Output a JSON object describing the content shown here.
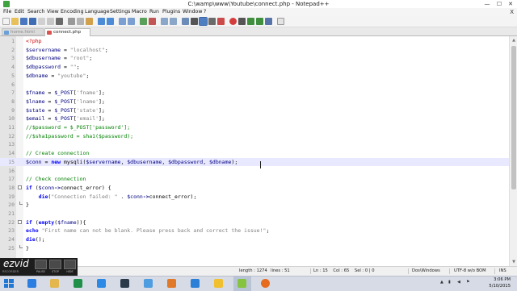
{
  "window": {
    "title": "C:\\wamp\\www\\Youtube\\connect.php - Notepad++",
    "minimize": "—",
    "maximize": "☐",
    "close": "✕"
  },
  "menu": [
    {
      "label": "File"
    },
    {
      "label": "Edit"
    },
    {
      "label": "Search"
    },
    {
      "label": "View"
    },
    {
      "label": "Encoding"
    },
    {
      "label": "Language"
    },
    {
      "label": "Settings"
    },
    {
      "label": "Macro"
    },
    {
      "label": "Run"
    },
    {
      "label": "Plugins"
    },
    {
      "label": "Window"
    },
    {
      "label": "?"
    }
  ],
  "menu_close": "X",
  "tabs": [
    {
      "label": "home.html",
      "active": false
    },
    {
      "label": "connect.php",
      "active": true
    }
  ],
  "code_lines": [
    {
      "n": "1",
      "html": "<span class=\"c-tag\">&lt;?php</span>"
    },
    {
      "n": "2",
      "html": "<span class=\"c-var\">$servername</span> = <span class=\"c-str\">\"localhost\"</span>;"
    },
    {
      "n": "3",
      "html": "<span class=\"c-var\">$dbusername</span> = <span class=\"c-str\">\"root\"</span>;"
    },
    {
      "n": "4",
      "html": "<span class=\"c-var\">$dbpassword</span> = <span class=\"c-str\">\"\"</span>;"
    },
    {
      "n": "5",
      "html": "<span class=\"c-var\">$dbname</span> = <span class=\"c-str\">\"youtube\"</span>;"
    },
    {
      "n": "6",
      "html": ""
    },
    {
      "n": "7",
      "html": "<span class=\"c-var\">$fname</span> = <span class=\"c-var\">$_POST</span>[<span class=\"c-str\">'fname'</span>];"
    },
    {
      "n": "8",
      "html": "<span class=\"c-var\">$lname</span> = <span class=\"c-var\">$_POST</span>[<span class=\"c-str\">'lname'</span>];"
    },
    {
      "n": "9",
      "html": "<span class=\"c-var\">$state</span> = <span class=\"c-var\">$_POST</span>[<span class=\"c-str\">'state'</span>];"
    },
    {
      "n": "10",
      "html": "<span class=\"c-var\">$email</span> = <span class=\"c-var\">$_POST</span>[<span class=\"c-str\">'email'</span>];"
    },
    {
      "n": "11",
      "html": "<span class=\"c-cm\">//$password = $_POST['password'];</span>"
    },
    {
      "n": "12",
      "html": "<span class=\"c-cm\">//$sha1password = sha1($password);</span>"
    },
    {
      "n": "13",
      "html": ""
    },
    {
      "n": "14",
      "html": "<span class=\"c-cm\">// Create connection</span>"
    },
    {
      "n": "15",
      "html": "<span class=\"c-var\">$conn</span> = <span class=\"c-kw\">new</span> mysqli(<span class=\"c-var\">$servername</span>, <span class=\"c-var\">$dbusername</span>, <span class=\"c-var\">$dbpassword</span>, <span class=\"c-var\">$dbname</span>);",
      "current": true
    },
    {
      "n": "16",
      "html": ""
    },
    {
      "n": "17",
      "html": "<span class=\"c-cm\">// Check connection</span>"
    },
    {
      "n": "18",
      "html": "<span class=\"c-kw\">if</span> (<span class=\"c-var\">$conn</span><span class=\"c-op\">-&gt;</span>connect_error) {",
      "fold": "open"
    },
    {
      "n": "19",
      "html": "    <span class=\"c-kw\">die</span>(<span class=\"c-str\">\"Connection failed: \"</span> . <span class=\"c-var\">$conn</span><span class=\"c-op\">-&gt;</span>connect_error);"
    },
    {
      "n": "20",
      "html": "}",
      "fold": "close"
    },
    {
      "n": "21",
      "html": ""
    },
    {
      "n": "22",
      "html": "<span class=\"c-kw\">if</span> (<span class=\"c-kw\">empty</span>(<span class=\"c-var\">$fname</span>)){",
      "fold": "open"
    },
    {
      "n": "23",
      "html": "<span class=\"c-kw\">echo</span> <span class=\"c-str\">\"First name can not be blank. Please press back and correct the issue!\"</span>;"
    },
    {
      "n": "24",
      "html": "<span class=\"c-kw\">die</span>();"
    },
    {
      "n": "25",
      "html": "}",
      "fold": "close"
    }
  ],
  "status": {
    "length": "length : 1274",
    "lines": "lines : 51",
    "position": "Ln : 15    Col : 65    Sel : 0 | 0",
    "eol": "Dos\\Windows",
    "encoding": "UTF-8 w/o BOM",
    "mode": "INS"
  },
  "ezvid": {
    "logo": "ezvid",
    "sub": "RECORDER",
    "buttons": [
      {
        "label": "PAUSE"
      },
      {
        "label": "STOP"
      },
      {
        "label": "HIDE"
      }
    ]
  },
  "taskbar": {
    "time": "3:06 PM",
    "date": "5/10/2015"
  },
  "colors": {
    "accent": "#0078d7",
    "current_line": "#e8e8ff",
    "keyword": "#0000ff",
    "comment": "#008000",
    "string": "#808080"
  }
}
